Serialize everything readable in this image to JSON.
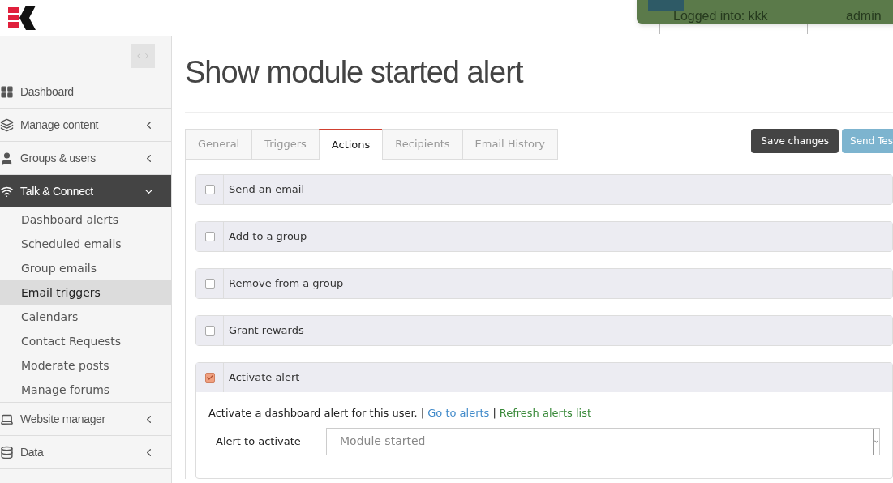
{
  "header": {
    "logged_into": "Logged into: kkk",
    "user": "admin"
  },
  "sidebar": {
    "items": [
      {
        "label": "Dashboard",
        "kind": "link",
        "expanded": false
      },
      {
        "label": "Manage content",
        "kind": "menu",
        "expanded": false
      },
      {
        "label": "Groups & users",
        "kind": "menu",
        "expanded": false
      },
      {
        "label": "Talk & Connect",
        "kind": "menu",
        "expanded": true,
        "children": [
          {
            "label": "Dashboard alerts",
            "selected": false
          },
          {
            "label": "Scheduled emails",
            "selected": false
          },
          {
            "label": "Group emails",
            "selected": false
          },
          {
            "label": "Email triggers",
            "selected": true
          },
          {
            "label": "Calendars",
            "selected": false
          },
          {
            "label": "Contact Requests",
            "selected": false
          },
          {
            "label": "Moderate posts",
            "selected": false
          },
          {
            "label": "Manage forums",
            "selected": false
          }
        ]
      },
      {
        "label": "Website manager",
        "kind": "menu",
        "expanded": false
      },
      {
        "label": "Data",
        "kind": "menu",
        "expanded": false
      }
    ]
  },
  "page_title": "Show module started alert",
  "tabs": [
    {
      "label": "General",
      "selected": false
    },
    {
      "label": "Triggers",
      "selected": false
    },
    {
      "label": "Actions",
      "selected": true
    },
    {
      "label": "Recipients",
      "selected": false
    },
    {
      "label": "Email History",
      "selected": false
    }
  ],
  "buttons": {
    "save": "Save changes",
    "send_test": "Send Tes"
  },
  "actions": [
    {
      "label": "Send an email",
      "checked": false
    },
    {
      "label": "Add to a group",
      "checked": false
    },
    {
      "label": "Remove from a group",
      "checked": false
    },
    {
      "label": "Grant rewards",
      "checked": false
    },
    {
      "label": "Activate alert",
      "checked": true,
      "description": "Activate a dashboard alert for this user. |",
      "link_go": "Go to alerts",
      "separator": "|",
      "link_refresh": "Refresh alerts list",
      "field_label": "Alert to activate",
      "field_value": "Module started"
    }
  ]
}
